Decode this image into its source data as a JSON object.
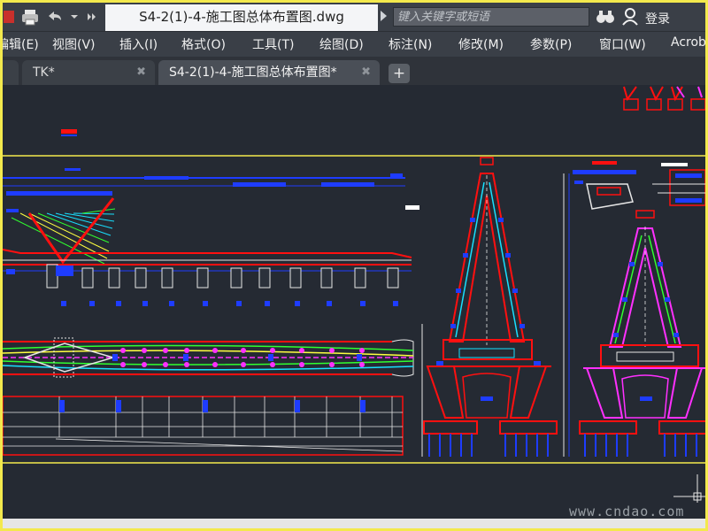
{
  "window": {
    "title": "S4-2(1)-4-施工图总体布置图.dwg",
    "search_placeholder": "键入关键字或短语",
    "login_label": "登录"
  },
  "menu": {
    "items": [
      "编辑(E)",
      "视图(V)",
      "插入(I)",
      "格式(O)",
      "工具(T)",
      "绘图(D)",
      "标注(N)",
      "修改(M)",
      "参数(P)",
      "窗口(W)",
      "Acrobat"
    ]
  },
  "tabs": [
    {
      "label": "",
      "active": false
    },
    {
      "label": "TK*",
      "active": false
    },
    {
      "label": "S4-2(1)-4-施工图总体布置图*",
      "active": true
    }
  ],
  "watermark": "www.cndao.com",
  "icons": {
    "app": "autocad-icon",
    "print": "print-icon",
    "undo": "undo-icon",
    "dropdown": "chevron-down-icon",
    "more": "double-chevron-right-icon",
    "binoculars": "binoculars-icon",
    "user": "user-icon",
    "add_tab": "plus-icon"
  },
  "colors": {
    "canvas": "#252a33",
    "title_bar": "#3a3f47",
    "frame_highlight": "#f3e94d",
    "red": "#ff1010",
    "blue": "#1e3cff",
    "cyan": "#18e0ff",
    "magenta": "#ff30ff",
    "yellow": "#ffff40",
    "green": "#30ff30",
    "white": "#e6e6e6"
  }
}
